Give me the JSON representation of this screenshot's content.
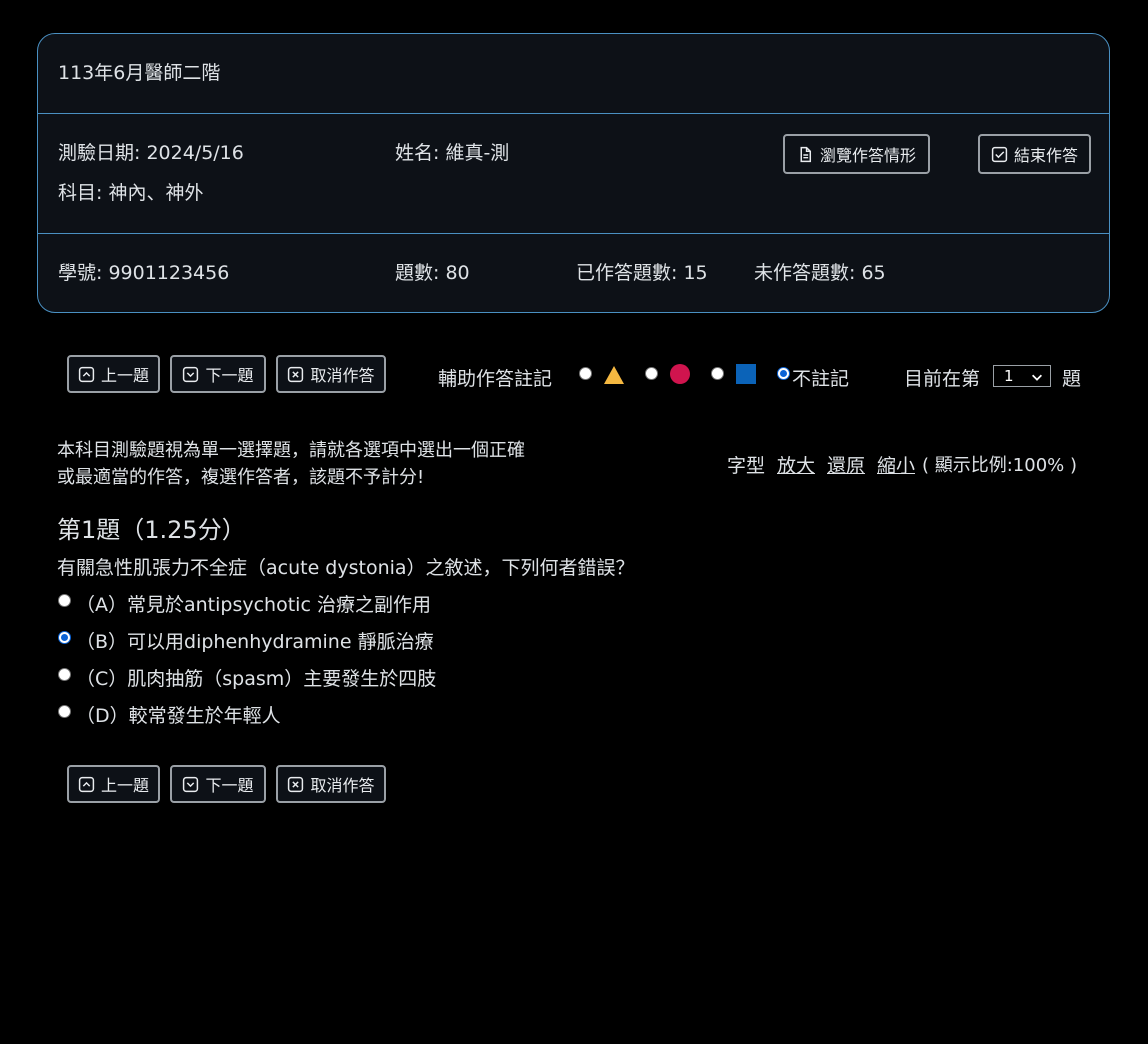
{
  "header": {
    "exam_title": "113年6月醫師二階",
    "test_date": "測驗日期: 2024/5/16",
    "name": "姓名: 維真-測",
    "subject": "科目: 神內、神外",
    "browse_label": "瀏覽作答情形",
    "finish_label": "結束作答",
    "student_id": "學號: 9901123456",
    "question_count": "題數: 80",
    "answered_count": "已作答題數: 15",
    "unanswered_count": "未作答題數: 65"
  },
  "toolbar": {
    "prev_label": "上一題",
    "next_label": "下一題",
    "cancel_label": "取消作答",
    "marker_label": "輔助作答註記",
    "no_mark_label": "不註記",
    "current_prefix": "目前在第",
    "current_value": "1",
    "current_suffix": "題",
    "marker_colors": {
      "triangle": "#f5b841",
      "circle": "#d0144e",
      "square": "#0b63b8"
    }
  },
  "instructions": {
    "line1": "本科目測驗題視為單一選擇題，請就各選項中選出一個正確",
    "line2": "或最適當的作答，複選作答者，該題不予計分!"
  },
  "font_controls": {
    "label": "字型",
    "enlarge": "放大",
    "reset": "還原",
    "shrink": "縮小",
    "ratio": "( 顯示比例:100% )"
  },
  "question": {
    "title": "第1題（1.25分）",
    "stem": "有關急性肌張力不全症（acute dystonia）之敘述，下列何者錯誤？",
    "options": [
      {
        "text": "（A）常見於antipsychotic 治療之副作用",
        "selected": false
      },
      {
        "text": "（B）可以用diphenhydramine 靜脈治療",
        "selected": true
      },
      {
        "text": "（C）肌肉抽筋（spasm）主要發生於四肢",
        "selected": false
      },
      {
        "text": "（D）較常發生於年輕人",
        "selected": false
      }
    ]
  },
  "bottom_toolbar": {
    "prev_label": "上一題",
    "next_label": "下一題",
    "cancel_label": "取消作答"
  }
}
